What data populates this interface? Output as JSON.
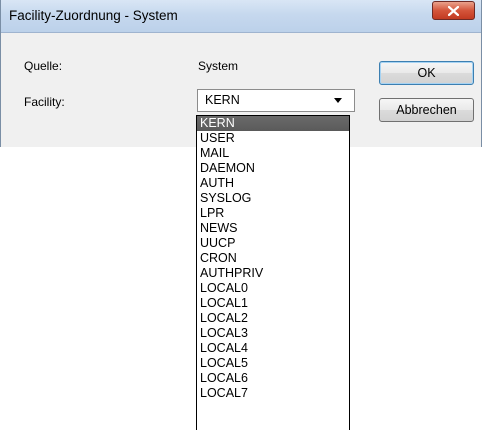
{
  "window": {
    "title": "Facility-Zuordnung - System"
  },
  "form": {
    "source_label": "Quelle:",
    "source_value": "System",
    "facility_label": "Facility:",
    "facility_value": "KERN"
  },
  "buttons": {
    "ok": "OK",
    "cancel": "Abbrechen"
  },
  "dropdown": {
    "selected_index": 0,
    "options": [
      "KERN",
      "USER",
      "MAIL",
      "DAEMON",
      "AUTH",
      "SYSLOG",
      "LPR",
      "NEWS",
      "UUCP",
      "CRON",
      "AUTHPRIV",
      "LOCAL0",
      "LOCAL1",
      "LOCAL2",
      "LOCAL3",
      "LOCAL4",
      "LOCAL5",
      "LOCAL6",
      "LOCAL7"
    ]
  },
  "icons": {
    "close": "close-icon",
    "combo_arrow": "chevron-down-icon"
  }
}
